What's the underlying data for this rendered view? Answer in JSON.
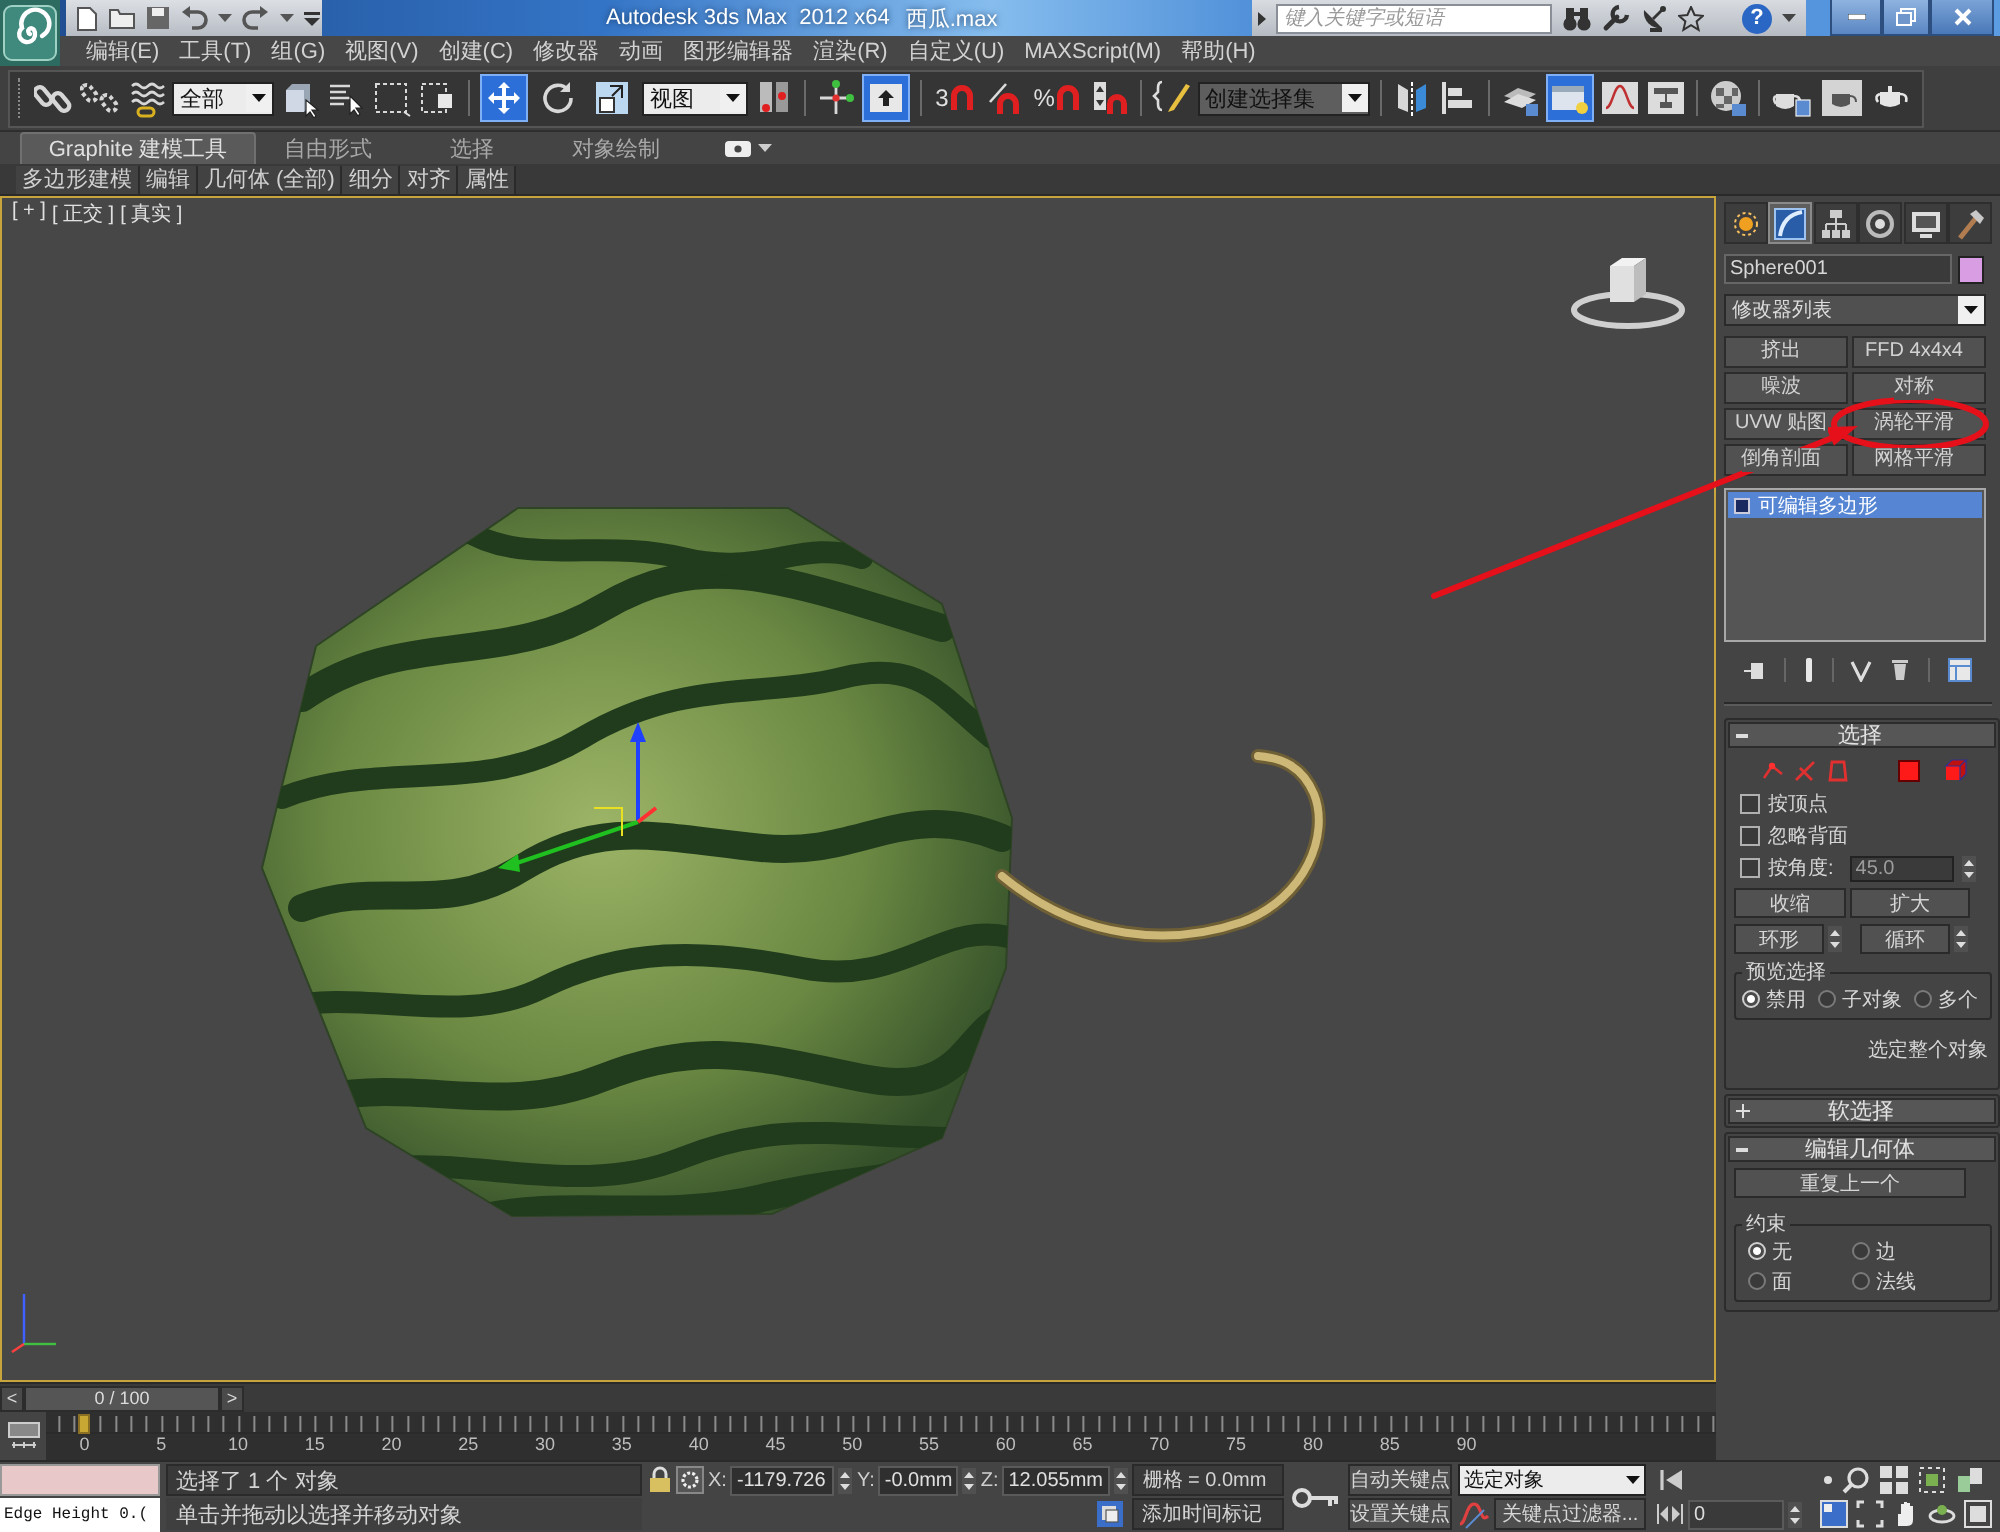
{
  "title_bar": {
    "app_title": "Autodesk 3ds Max  2012 x64",
    "file_name": "西瓜.max",
    "search": {
      "placeholder": "键入关键字或短语"
    },
    "help": "?"
  },
  "menu_bar": [
    "编辑(E)",
    "工具(T)",
    "组(G)",
    "视图(V)",
    "创建(C)",
    "修改器",
    "动画",
    "图形编辑器",
    "渲染(R)",
    "自定义(U)",
    "MAXScript(M)",
    "帮助(H)"
  ],
  "main_toolbar": {
    "selection_filter": "全部",
    "transform_tools": [
      {
        "selected": true
      },
      {
        "selected": false
      },
      {
        "selected": false
      }
    ],
    "reference_coordinate": "视图",
    "shortcut_override": {
      "on": true
    },
    "snap_toggle": "3",
    "percent_snap": "%",
    "named_selection": "创建选择集",
    "ribbon_toggle": {
      "on": true
    }
  },
  "ribbon": {
    "tabs": [
      {
        "label": "Graphite 建模工具",
        "selected": true
      },
      {
        "label": "自由形式",
        "selected": false
      },
      {
        "label": "选择",
        "selected": false
      },
      {
        "label": "对象绘制",
        "selected": false
      }
    ],
    "panels": [
      "多边形建模",
      "编辑",
      "几何体 (全部)",
      "细分",
      "对齐",
      "属性"
    ]
  },
  "viewport": {
    "labels": [
      "[ + ]",
      "[ 正交 ]",
      "[ 真实 ]"
    ],
    "active": true
  },
  "command_panel": {
    "tabs": [
      {
        "selected": false
      },
      {
        "selected": true
      },
      {
        "selected": false
      },
      {
        "selected": false
      },
      {
        "selected": false
      },
      {
        "selected": false
      }
    ],
    "object_name": "Sphere001",
    "modifier_list": "修改器列表",
    "modifier_buttons": [
      "挤出",
      "FFD 4x4x4",
      "噪波",
      "对称",
      "UVW 贴图",
      "涡轮平滑",
      "倒角剖面",
      "网格平滑"
    ],
    "modifier_stack": [
      {
        "label": "可编辑多边形",
        "selected": true
      }
    ],
    "selection_rollout": {
      "title": "选择",
      "expanded": true,
      "checkboxes": [
        {
          "label": "按顶点",
          "checked": false
        },
        {
          "label": "忽略背面",
          "checked": false
        },
        {
          "label": "按角度:",
          "checked": false,
          "field": {
            "value": "45.0",
            "disabled": true
          }
        }
      ],
      "grow_buttons": [
        "收缩",
        "扩大"
      ],
      "loop_buttons": [
        "环形",
        "循环"
      ],
      "preview_selection": {
        "title": "预览选择",
        "options": [
          {
            "label": "禁用",
            "selected": true
          },
          {
            "label": "子对象",
            "selected": false
          },
          {
            "label": "多个",
            "selected": false
          }
        ]
      },
      "status": "选定整个对象"
    },
    "soft_selection_rollout": {
      "title": "软选择",
      "expanded": false
    },
    "edit_geometry_rollout": {
      "title": "编辑几何体",
      "expanded": true,
      "repeat_button": "重复上一个",
      "constraints": {
        "title": "约束",
        "options": [
          {
            "label": "无",
            "selected": true
          },
          {
            "label": "边",
            "selected": false
          },
          {
            "label": "面",
            "selected": false
          },
          {
            "label": "法线",
            "selected": false
          }
        ]
      }
    }
  },
  "time_slider": {
    "previous": "<",
    "position": "0 / 100",
    "next": ">"
  },
  "track_bar": {
    "ticks": [
      "0",
      "5",
      "10",
      "15",
      "20",
      "25",
      "30",
      "35",
      "40",
      "45",
      "50",
      "55",
      "60",
      "65",
      "70",
      "75",
      "80",
      "85",
      "90"
    ]
  },
  "status_bar": {
    "listener_output": "Edge Height 0.(",
    "selection_status": "选择了 1 个 对象",
    "prompt": "单击并拖动以选择并移动对象",
    "coordinates": [
      {
        "axis": "X:",
        "value": "-1179.726"
      },
      {
        "axis": "Y:",
        "value": "-0.0mm"
      },
      {
        "axis": "Z:",
        "value": "12.055mm"
      }
    ],
    "grid": "栅格 = 0.0mm",
    "time_tag": "添加时间标记",
    "auto_key": "自动关键点",
    "set_key": "设置关键点",
    "key_target": "选定对象",
    "key_filters": "关键点过滤器...",
    "current_frame": "0"
  }
}
